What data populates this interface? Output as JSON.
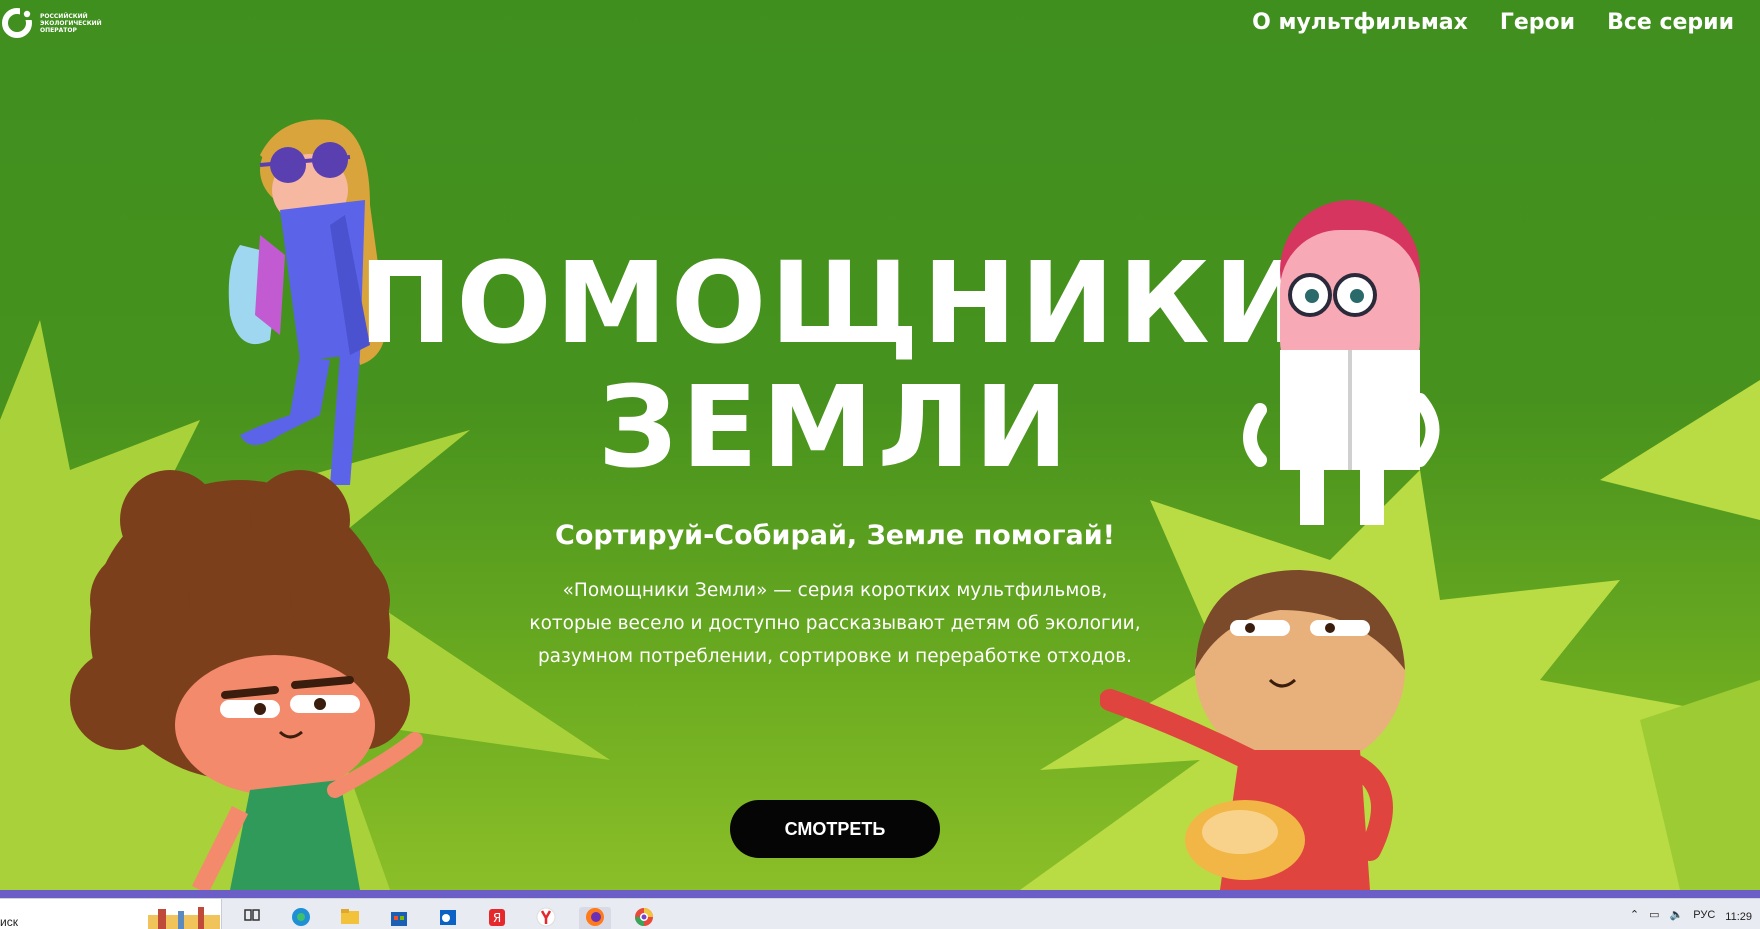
{
  "header": {
    "logo_text": "Российский экологический оператор",
    "nav": [
      {
        "label": "О мультфильмах"
      },
      {
        "label": "Герои"
      },
      {
        "label": "Все серии"
      }
    ]
  },
  "hero": {
    "title_line1": "ПОМОЩНИКИ",
    "title_line2": "ЗЕМЛИ",
    "slogan": "Сортируй-Собирай, Земле помогай!",
    "description": "«Помощники Земли» — серия коротких мультфильмов, которые весело и доступно рассказывают детям об экологии, разумном потреблении, сортировке и переработке отходов.",
    "cta_label": "СМОТРЕТЬ"
  },
  "taskbar": {
    "search_text": "иск",
    "language": "РУС",
    "time": "11:29",
    "apps": [
      "task-view-icon",
      "edge-icon",
      "file-explorer-icon",
      "store-icon",
      "outlook-icon",
      "yandex-browser-icon",
      "yandex-icon",
      "firefox-icon",
      "chrome-like-icon"
    ]
  },
  "colors": {
    "background_green": "#47921e",
    "burst_green": "#b9dc44",
    "button_black": "#050505",
    "taskbar_accent": "#6b5fc7"
  }
}
